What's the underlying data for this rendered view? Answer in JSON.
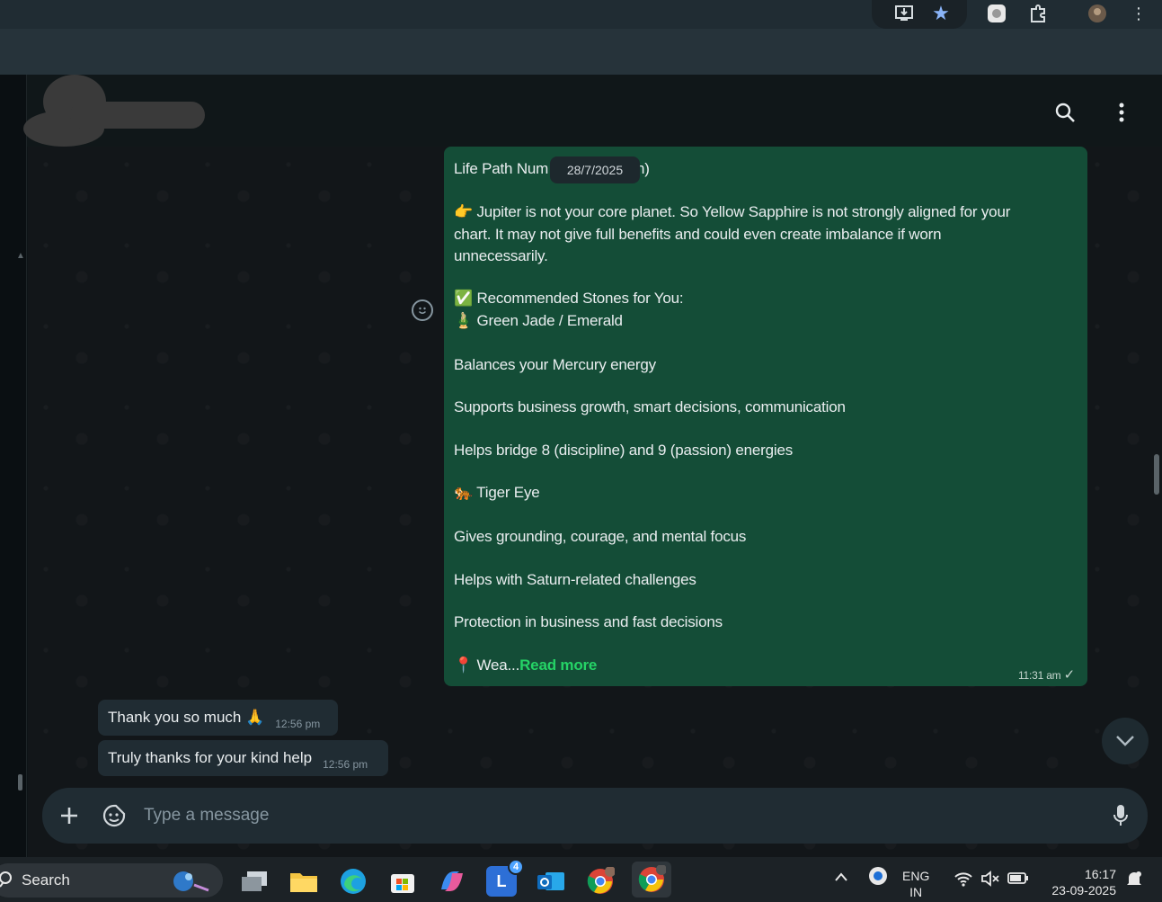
{
  "browser": {
    "icons": [
      "install-app-icon",
      "bookmark-star-icon",
      "extension-app-icon",
      "extensions-puzzle-icon",
      "profile-avatar-icon",
      "more-menu-icon"
    ]
  },
  "header": {
    "contact_name": "",
    "icons": [
      "search-icon",
      "more-options-icon"
    ]
  },
  "chat": {
    "date_chip": "28/7/2025",
    "outgoing": {
      "lines": [
        "Life Path Num",
        "n)",
        "👉 Jupiter is not your core planet. So Yellow Sapphire is not strongly aligned for your",
        "chart. It may not give full benefits and could even create imbalance if worn",
        "unnecessarily.",
        "✅ Recommended Stones for You:",
        "🎍 Green Jade / Emerald",
        "Balances your Mercury energy",
        "Supports business growth, smart decisions, communication",
        "Helps bridge 8 (discipline) and 9 (passion) energies",
        "🐅 Tiger Eye",
        "Gives grounding, courage, and mental focus",
        "Helps with Saturn-related challenges",
        "Protection in business and fast decisions",
        "📍 Wea..."
      ],
      "read_more": "Read more",
      "time": "11:31 am",
      "tick": "✓"
    },
    "incoming": [
      {
        "text": "Thank you so much 🙏",
        "time": "12:56 pm"
      },
      {
        "text": "Truly thanks for your kind help",
        "time": "12:56 pm"
      }
    ]
  },
  "composer": {
    "placeholder": "Type a message",
    "icons": [
      "plus-icon",
      "sticker-icon",
      "microphone-icon"
    ]
  },
  "taskbar": {
    "search_label": "Search",
    "apps": [
      {
        "name": "task-view",
        "badge": ""
      },
      {
        "name": "file-explorer",
        "badge": ""
      },
      {
        "name": "edge",
        "badge": ""
      },
      {
        "name": "microsoft-store",
        "badge": ""
      },
      {
        "name": "copilot",
        "badge": ""
      },
      {
        "name": "teams-l",
        "badge": "4"
      },
      {
        "name": "outlook",
        "badge": ""
      },
      {
        "name": "chrome-profile",
        "badge": ""
      },
      {
        "name": "chrome",
        "badge": ""
      }
    ],
    "lang_top": "ENG",
    "lang_bottom": "IN",
    "time": "16:17",
    "date": "23-09-2025"
  },
  "colors": {
    "outgoing_bubble": "#144d37",
    "incoming_bubble": "#202c33",
    "read_more": "#25d366",
    "app_bg": "#0e1417"
  }
}
